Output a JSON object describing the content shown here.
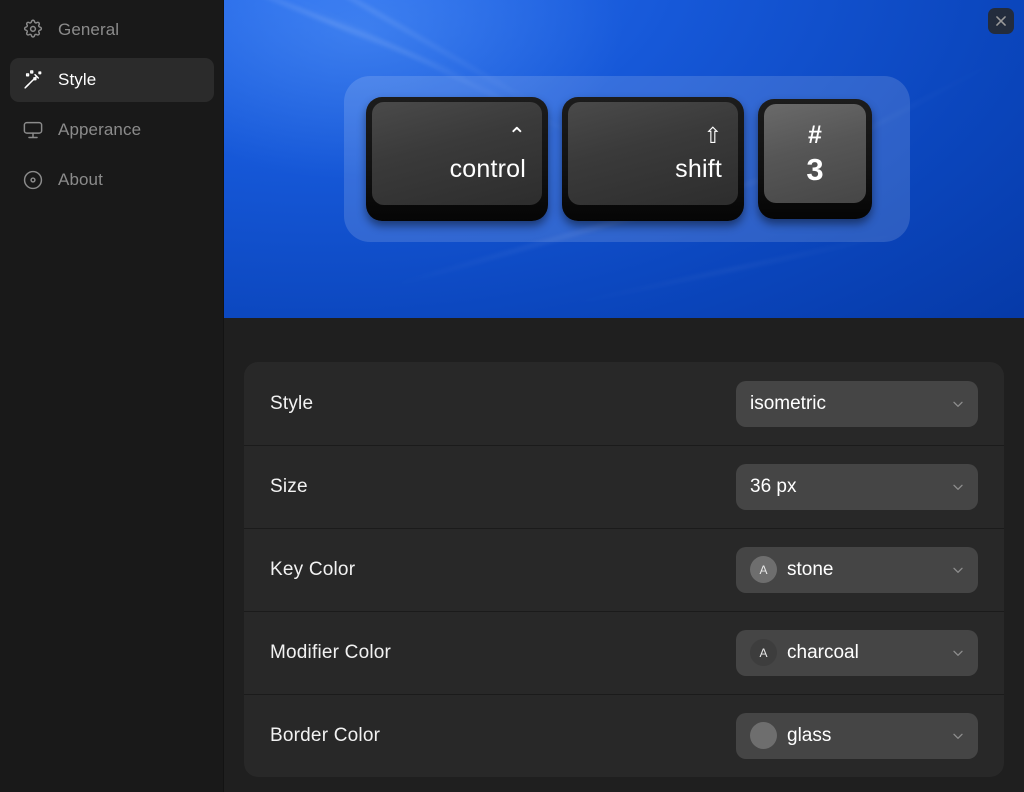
{
  "sidebar": {
    "items": [
      {
        "label": "General",
        "icon": "gear-icon",
        "selected": false
      },
      {
        "label": "Style",
        "icon": "wand-icon",
        "selected": true
      },
      {
        "label": "Apperance",
        "icon": "monitor-icon",
        "selected": false
      },
      {
        "label": "About",
        "icon": "info-disc-icon",
        "selected": false
      }
    ]
  },
  "preview": {
    "close_label": "×",
    "background_color": "#1658d8",
    "panel_color": "rgba(255,255,255,0.14)",
    "keys": [
      {
        "symbol": "⌃",
        "name": "control",
        "type": "modifier",
        "color": "charcoal"
      },
      {
        "symbol": "⇧",
        "name": "shift",
        "type": "modifier",
        "color": "charcoal"
      },
      {
        "symbol": "#",
        "name": "3",
        "type": "key",
        "color": "stone"
      }
    ]
  },
  "settings": {
    "rows": [
      {
        "label": "Style",
        "value": "isometric",
        "swatch": null,
        "swatch_letter": null
      },
      {
        "label": "Size",
        "value": "36 px",
        "swatch": null,
        "swatch_letter": null
      },
      {
        "label": "Key Color",
        "value": "stone",
        "swatch": "#6e6e6e",
        "swatch_letter": "A"
      },
      {
        "label": "Modifier Color",
        "value": "charcoal",
        "swatch": "#3d3d3d",
        "swatch_letter": "A"
      },
      {
        "label": "Border Color",
        "value": "glass",
        "swatch": "#6e6e6e",
        "swatch_letter": ""
      }
    ]
  }
}
